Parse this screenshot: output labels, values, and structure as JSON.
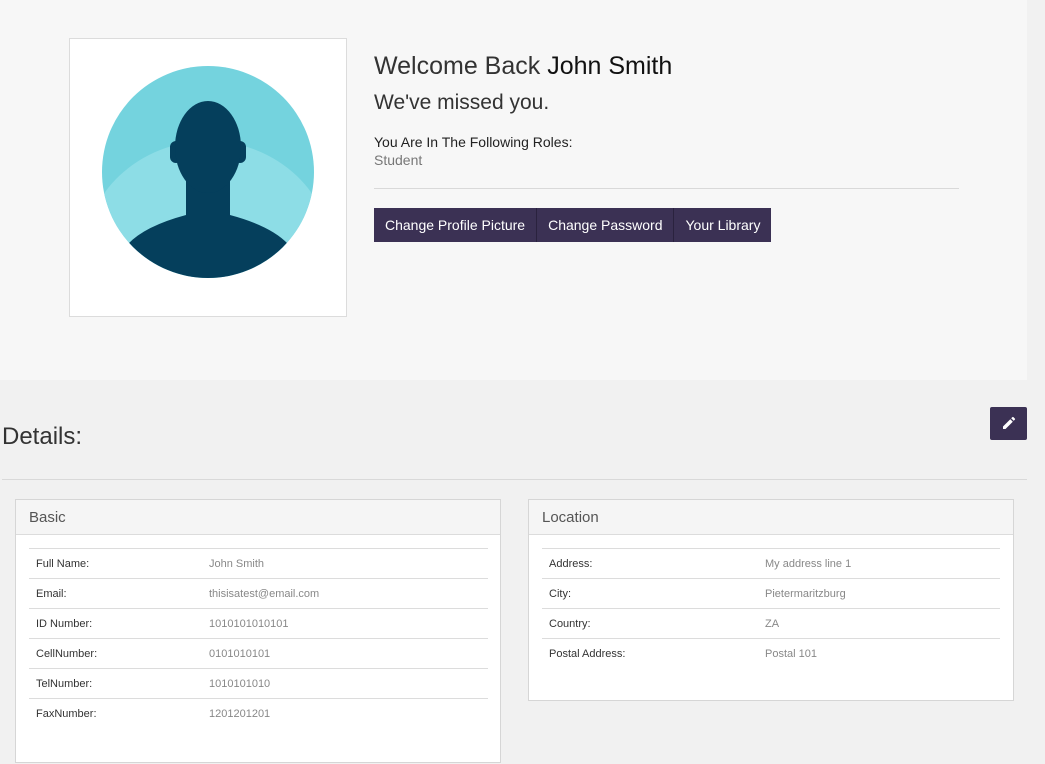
{
  "profile": {
    "welcome_prefix": "Welcome Back",
    "user_name": "John Smith",
    "missed_message": "We've missed you.",
    "roles_label": "You Are In The Following Roles:",
    "roles_value": "Student",
    "avatar_icon": "user-silhouette-icon"
  },
  "actions": {
    "change_picture": "Change Profile Picture",
    "change_password": "Change Password",
    "library": "Your Library"
  },
  "details": {
    "title": "Details:",
    "edit_icon": "pencil-icon"
  },
  "basic": {
    "heading": "Basic",
    "rows": [
      {
        "label": "Full Name:",
        "value": "John Smith"
      },
      {
        "label": "Email:",
        "value": "thisisatest@email.com"
      },
      {
        "label": "ID Number:",
        "value": "1010101010101"
      },
      {
        "label": "CellNumber:",
        "value": "0101010101"
      },
      {
        "label": "TelNumber:",
        "value": "1010101010"
      },
      {
        "label": "FaxNumber:",
        "value": "1201201201"
      }
    ]
  },
  "location": {
    "heading": "Location",
    "rows": [
      {
        "label": "Address:",
        "value": "My address line 1"
      },
      {
        "label": "City:",
        "value": "Pietermaritzburg"
      },
      {
        "label": "Country:",
        "value": "ZA"
      },
      {
        "label": "Postal Address:",
        "value": "Postal 101"
      }
    ]
  },
  "colors": {
    "accent": "#3b3154",
    "avatar_bg": "#74d3de",
    "avatar_silhouette": "#053f5c"
  }
}
